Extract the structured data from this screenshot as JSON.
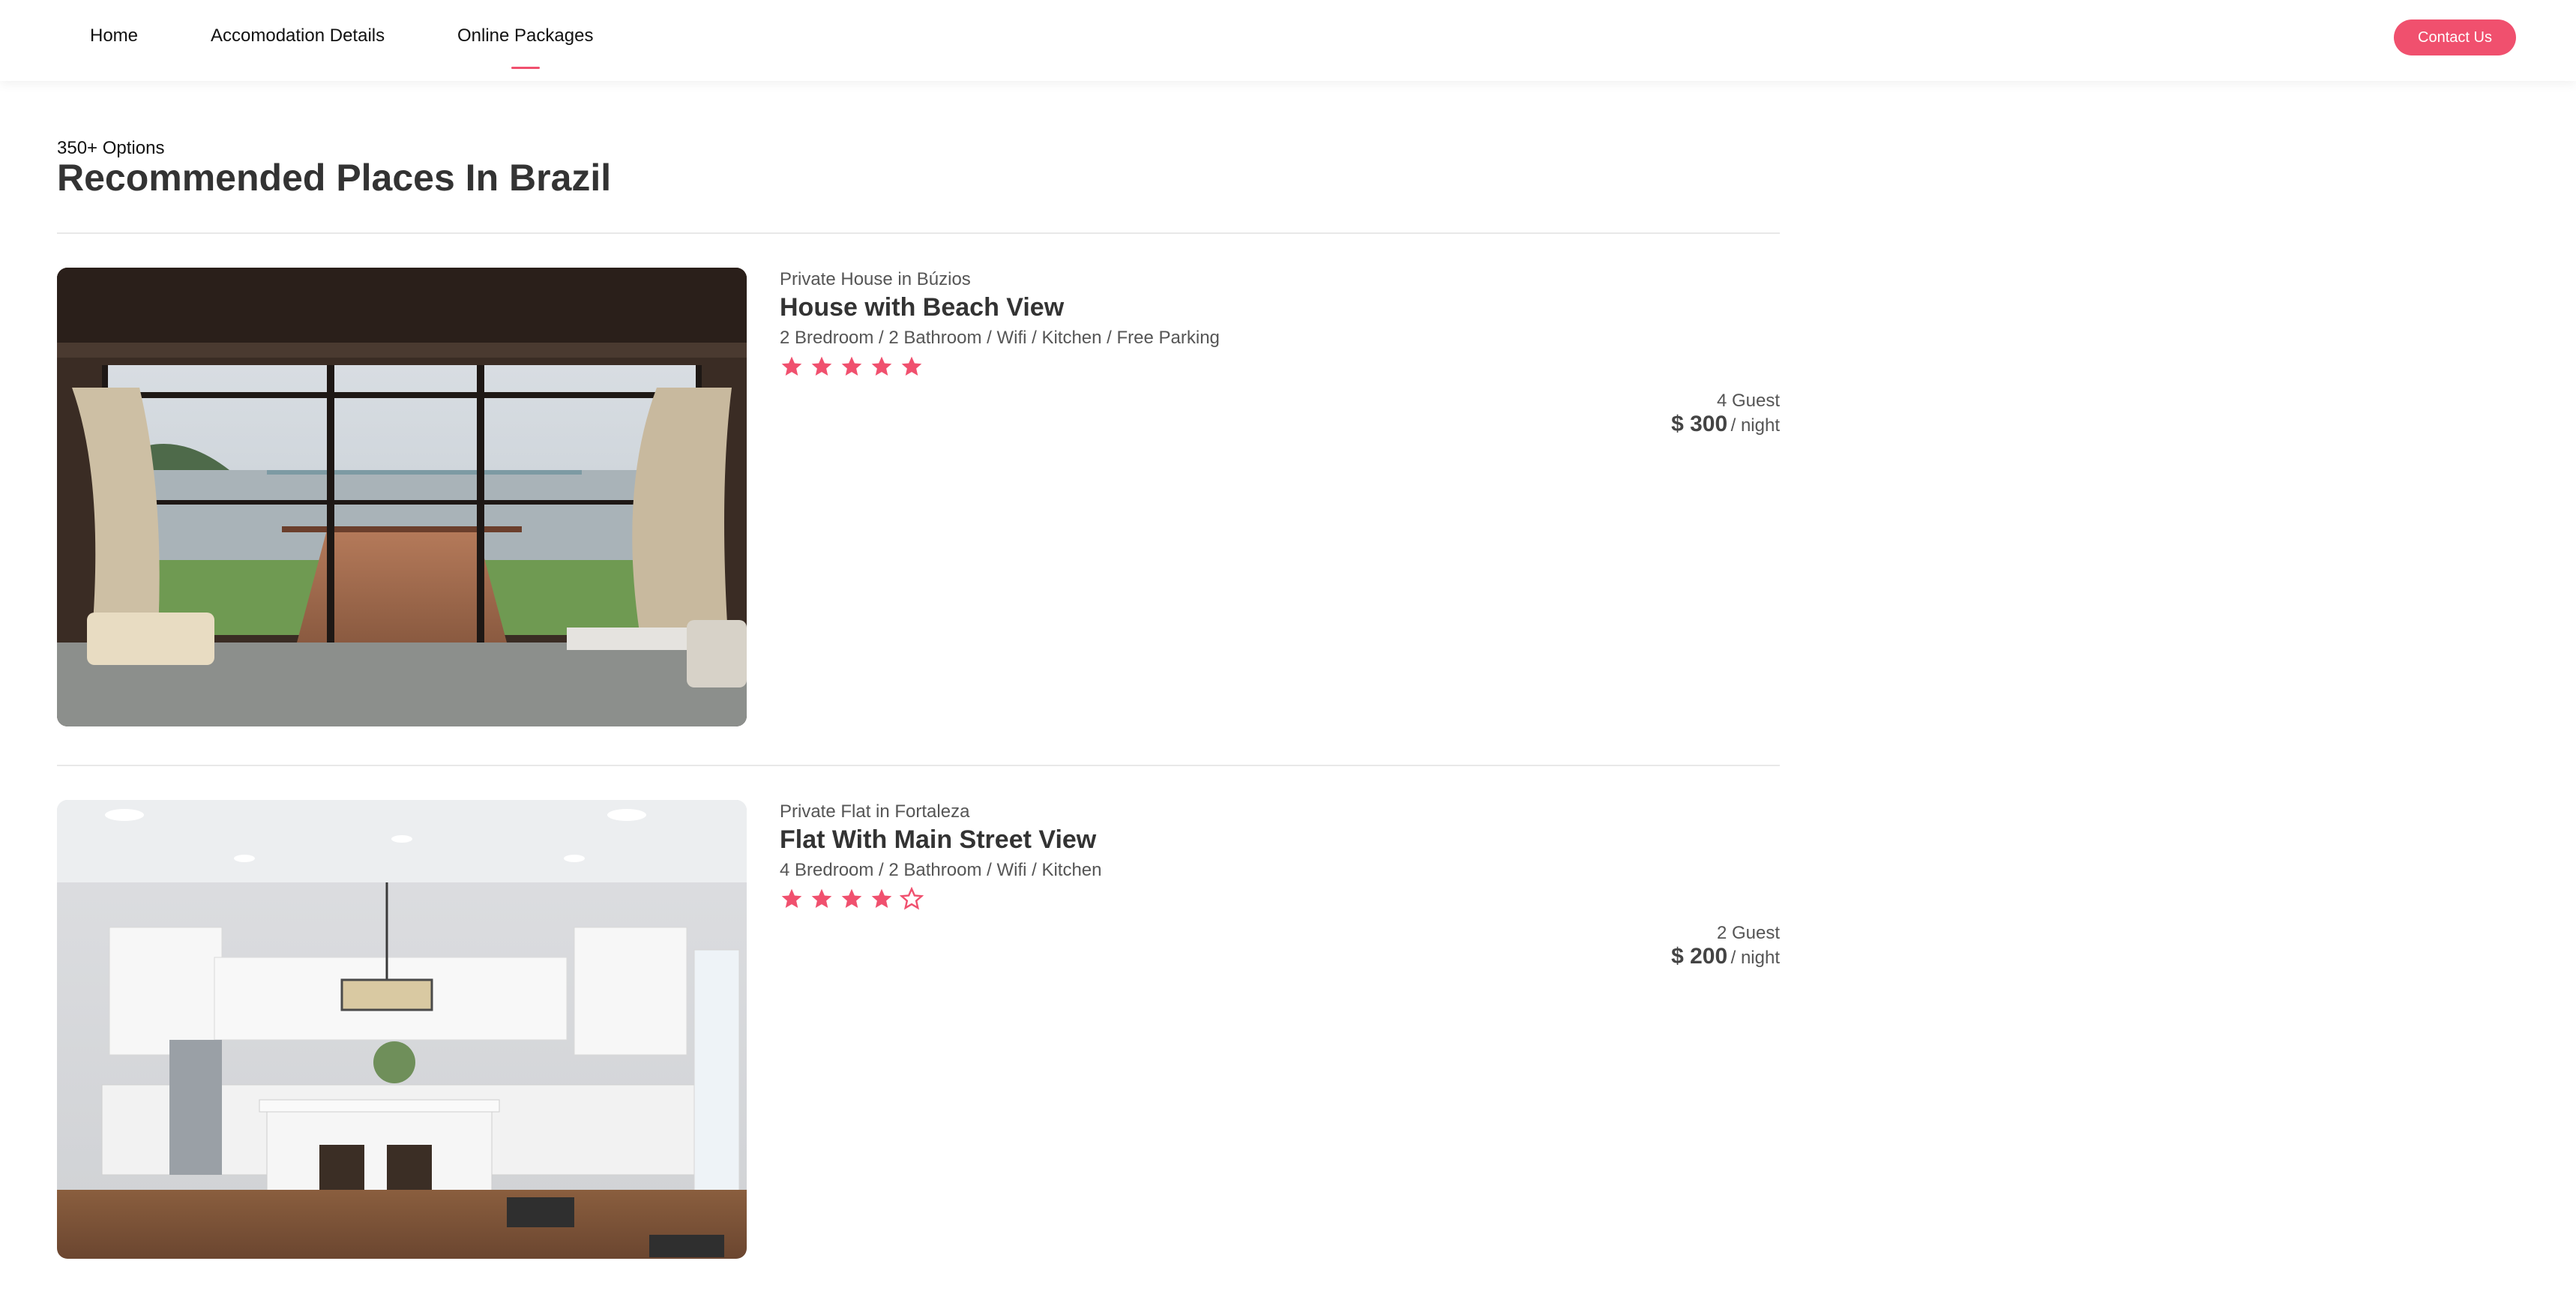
{
  "nav": {
    "links": [
      "Home",
      "Accomodation Details",
      "Online Packages"
    ],
    "active_index": 2,
    "contact_label": "Contact Us"
  },
  "heading": {
    "options": "350+ Options",
    "title": "Recommended Places In Brazil"
  },
  "listings": [
    {
      "type": "Private House in Búzios",
      "name": "House with Beach View",
      "amenities": "2 Bredroom / 2 Bathroom / Wifi / Kitchen / Free Parking",
      "rating": 5,
      "max_rating": 5,
      "guests": "4 Guest",
      "price": "$ 300",
      "per": "/ night",
      "image": "beach-view-room-photo"
    },
    {
      "type": "Private Flat in Fortaleza",
      "name": "Flat With Main Street View",
      "amenities": "4 Bredroom / 2 Bathroom / Wifi / Kitchen",
      "rating": 4,
      "max_rating": 5,
      "guests": "2 Guest",
      "price": "$ 200",
      "per": "/ night",
      "image": "kitchen-photo"
    }
  ],
  "colors": {
    "accent": "#f0506e",
    "title": "#333333",
    "muted": "#555555",
    "divider": "#e8e8e8"
  },
  "icons": {
    "star_full": "star-filled-icon",
    "star_empty": "star-outline-icon"
  }
}
